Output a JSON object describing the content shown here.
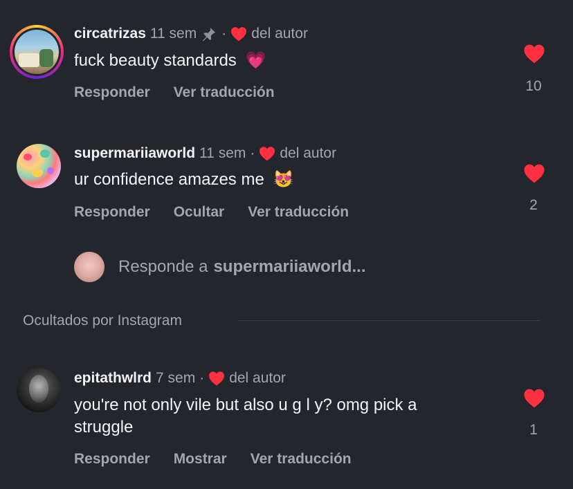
{
  "comments": [
    {
      "username": "circatrizas",
      "time": "11 sem",
      "author_like": "del autor",
      "text": "fuck beauty standards",
      "emoji": "💗",
      "actions": [
        "Responder",
        "Ver traducción"
      ],
      "likes": "10",
      "pinned": true
    },
    {
      "username": "supermariiaworld",
      "time": "11 sem",
      "author_like": "del autor",
      "text": "ur confidence amazes me",
      "emoji": "😻",
      "actions": [
        "Responder",
        "Ocultar",
        "Ver traducción"
      ],
      "likes": "2",
      "pinned": false
    },
    {
      "username": "epitathwlrd",
      "time": "7 sem",
      "author_like": "del autor",
      "text_line1": "you're not only vile but also u g l y? omg pick a",
      "text_line2": "struggle",
      "actions": [
        "Responder",
        "Mostrar",
        "Ver traducción"
      ],
      "likes": "1",
      "pinned": false
    }
  ],
  "reply_prompt": {
    "prefix": "Responde a",
    "target": "supermariiaworld..."
  },
  "hidden_section": {
    "label": "Ocultados por Instagram"
  },
  "colors": {
    "background": "#24262d",
    "heart": "#ff3040",
    "muted": "#a4a6ad"
  },
  "icons": [
    "pin-icon",
    "author-heart-icon",
    "like-heart-icon",
    "avatar"
  ]
}
